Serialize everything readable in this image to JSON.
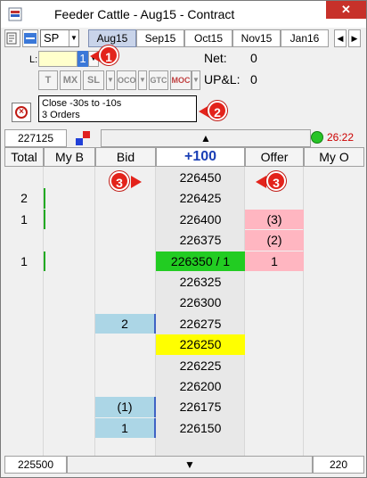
{
  "window": {
    "title": "Feeder Cattle - Aug15 - Contract",
    "close_glyph": "✕"
  },
  "toolbar": {
    "symbol": "SP",
    "tabs": [
      "Aug15",
      "Sep15",
      "Oct15",
      "Nov15",
      "Jan16"
    ],
    "active_tab": "Aug15",
    "scroll_left": "◀",
    "scroll_right": "▶"
  },
  "order_entry": {
    "qty_label": "L:",
    "qty_value": "1",
    "net_label": "Net:",
    "net_value": "0",
    "upl_label": "UP&L:",
    "upl_value": "0",
    "order_type_buttons": [
      "T",
      "MX",
      "SL",
      "OCO",
      "GTC",
      "MOC"
    ],
    "order_info_line1": "Close -30s to -10s",
    "order_info_line2": "3 Orders"
  },
  "callouts": [
    "1",
    "2",
    "3",
    "3"
  ],
  "status": {
    "last_price": "227125",
    "up_arrow": "▲",
    "clock": "26:22",
    "connection": "connected"
  },
  "ladder": {
    "headers": [
      "Total",
      "My B",
      "Bid",
      "+100",
      "Offer",
      "My O"
    ],
    "rows": [
      {
        "total": "",
        "my_bid": "",
        "bid": "",
        "price": "226450",
        "offer": "",
        "my_offer": "",
        "price_style": "normal"
      },
      {
        "total": "2",
        "my_bid": "",
        "bid": "",
        "price": "226425",
        "offer": "",
        "my_offer": "",
        "price_style": "normal"
      },
      {
        "total": "1",
        "my_bid": "",
        "bid": "",
        "price": "226400",
        "offer": "(3)",
        "my_offer": "",
        "price_style": "normal"
      },
      {
        "total": "",
        "my_bid": "",
        "bid": "",
        "price": "226375",
        "offer": "(2)",
        "my_offer": "",
        "price_style": "normal"
      },
      {
        "total": "1",
        "my_bid": "",
        "bid": "",
        "price": "226350 / 1",
        "offer": "1",
        "my_offer": "",
        "price_style": "last"
      },
      {
        "total": "",
        "my_bid": "",
        "bid": "",
        "price": "226325",
        "offer": "",
        "my_offer": "",
        "price_style": "normal"
      },
      {
        "total": "",
        "my_bid": "",
        "bid": "",
        "price": "226300",
        "offer": "",
        "my_offer": "",
        "price_style": "normal"
      },
      {
        "total": "",
        "my_bid": "",
        "bid": "2",
        "price": "226275",
        "offer": "",
        "my_offer": "",
        "price_style": "normal"
      },
      {
        "total": "",
        "my_bid": "",
        "bid": "",
        "price": "226250",
        "offer": "",
        "my_offer": "",
        "price_style": "highlight"
      },
      {
        "total": "",
        "my_bid": "",
        "bid": "",
        "price": "226225",
        "offer": "",
        "my_offer": "",
        "price_style": "normal"
      },
      {
        "total": "",
        "my_bid": "",
        "bid": "",
        "price": "226200",
        "offer": "",
        "my_offer": "",
        "price_style": "normal"
      },
      {
        "total": "",
        "my_bid": "",
        "bid": "(1)",
        "price": "226175",
        "offer": "",
        "my_offer": "",
        "price_style": "normal"
      },
      {
        "total": "",
        "my_bid": "",
        "bid": "1",
        "price": "226150",
        "offer": "",
        "my_offer": "",
        "price_style": "normal"
      }
    ]
  },
  "bottom": {
    "left_value": "225500",
    "down_arrow": "▼",
    "right_value": "220"
  },
  "colors": {
    "bid_bg": "#acd6e6",
    "offer_bg": "#ffb6c1",
    "last_trade_bg": "#22cc22",
    "highlight_bg": "#ffff00",
    "price_header": "#1a3fb5"
  }
}
